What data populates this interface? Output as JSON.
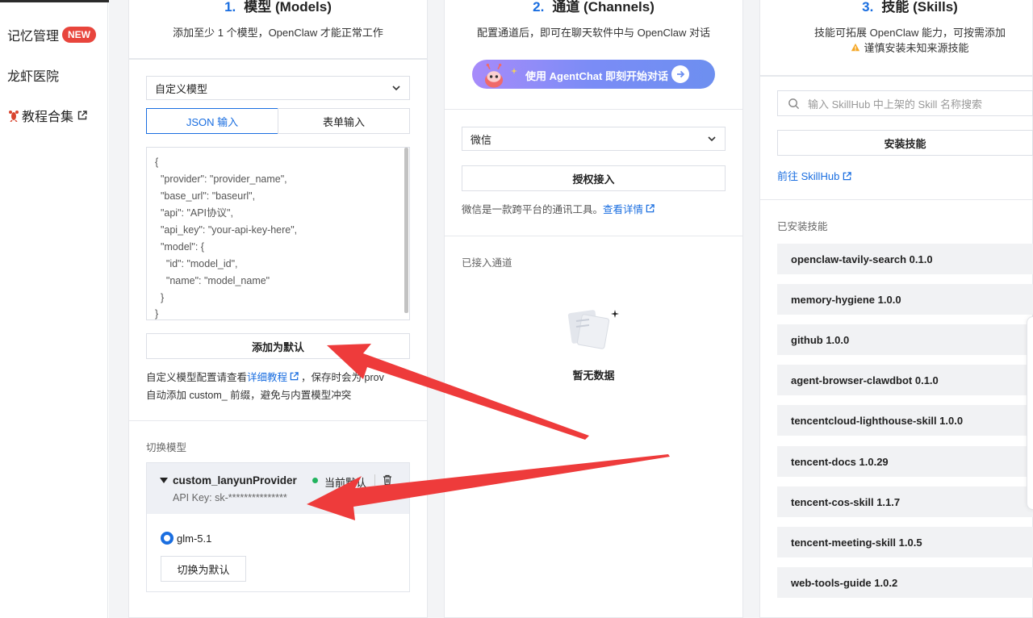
{
  "sidebar": {
    "items": [
      {
        "label": "记忆管理",
        "badge": "NEW"
      },
      {
        "label": "龙虾医院"
      },
      {
        "label": "教程合集"
      }
    ]
  },
  "models": {
    "num": "1.",
    "title": "模型 (Models)",
    "subtitle": "添加至少 1 个模型，OpenClaw 才能正常工作",
    "select_value": "自定义模型",
    "tabs": [
      "JSON 输入",
      "表单输入"
    ],
    "json_lines": [
      "{",
      "  \"provider\": \"provider_name\",",
      "  \"base_url\": \"baseurl\",",
      "  \"api\": \"API协议\",",
      "  \"api_key\": \"your-api-key-here\",",
      "  \"model\": {",
      "    \"id\": \"model_id\",",
      "    \"name\": \"model_name\"",
      "  }",
      "}"
    ],
    "add_default_button": "添加为默认",
    "note_prefix": "自定义模型配置请查看",
    "note_link": "详细教程",
    "note_suffix": "，保存时会为 prov",
    "note_line2": "自动添加 custom_ 前缀，避免与内置模型冲突",
    "switch_label": "切换模型",
    "provider": {
      "name": "custom_lanyunProvider",
      "api_key": "API Key: sk-***************",
      "status": "当前默认"
    },
    "model_option": "glm-5.1",
    "switch_button": "切换为默认"
  },
  "channels": {
    "num": "2.",
    "title": "通道 (Channels)",
    "subtitle": "配置通道后，即可在聊天软件中与 OpenClaw 对话",
    "banner_text": "使用 AgentChat 即刻开始对话",
    "select_value": "微信",
    "authorize_button": "授权接入",
    "desc": "微信是一款跨平台的通讯工具。",
    "desc_link": "查看详情",
    "connected_label": "已接入通道",
    "empty_text": "暂无数据"
  },
  "skills": {
    "num": "3.",
    "title": "技能 (Skills)",
    "subtitle": "技能可拓展 OpenClaw 能力，可按需添加",
    "warning": "谨慎安装未知来源技能",
    "search_placeholder": "输入 SkillHub 中上架的 Skill 名称搜索",
    "install_button": "安装技能",
    "skillhub_link": "前往 SkillHub",
    "installed_label": "已安装技能",
    "list": [
      "openclaw-tavily-search 0.1.0",
      "memory-hygiene 1.0.0",
      "github 1.0.0",
      "agent-browser-clawdbot 0.1.0",
      "tencentcloud-lighthouse-skill 1.0.0",
      "tencent-docs 1.0.29",
      "tencent-cos-skill 1.1.7",
      "tencent-meeting-skill 1.0.5",
      "web-tools-guide 1.0.2"
    ]
  },
  "colors": {
    "accent": "#1a6ee0",
    "badge": "#e8453c",
    "arrow": "#ee3b3b"
  }
}
